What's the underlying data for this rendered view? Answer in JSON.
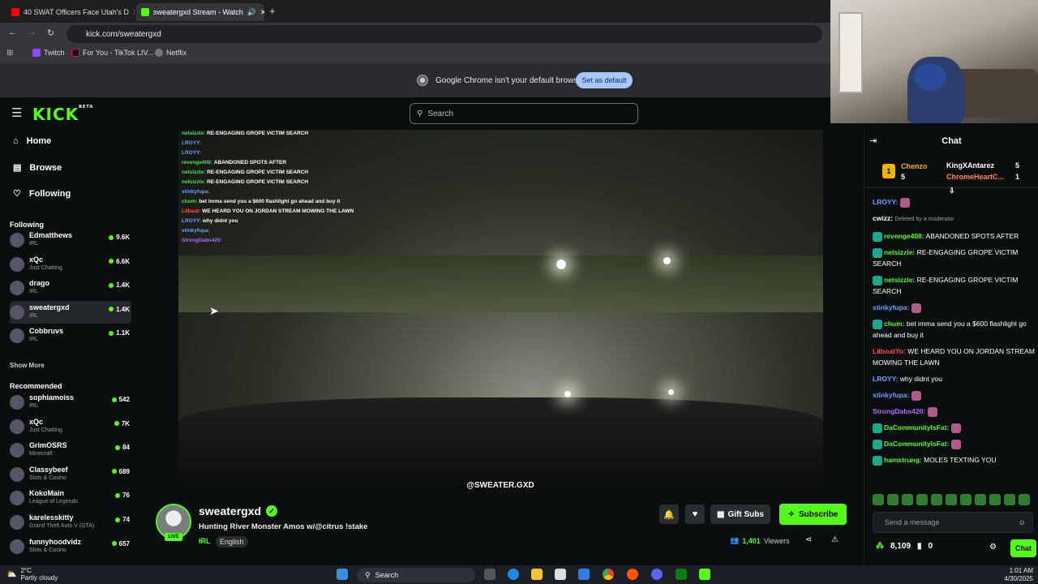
{
  "browser": {
    "tabs": [
      {
        "label": "40 SWAT Officers Face Utah's D",
        "favicon_color": "#ff0000"
      },
      {
        "label": "sweatergxd Stream - Watch",
        "favicon_color": "#53fc18"
      }
    ],
    "url": "kick.com/sweatergxd",
    "bookmarks": [
      "Twitch",
      "For You - TikTok LIV...",
      "Netflix"
    ],
    "infobar_text": "Google Chrome isn't your default browser",
    "infobar_button": "Set as default"
  },
  "header": {
    "logo": "KICK",
    "logo_badge": "BETA",
    "search_placeholder": "Search"
  },
  "sidebar": {
    "nav": [
      {
        "label": "Home",
        "icon": "home-icon"
      },
      {
        "label": "Browse",
        "icon": "browse-icon"
      },
      {
        "label": "Following",
        "icon": "heart-icon"
      }
    ],
    "following_title": "Following",
    "following": [
      {
        "name": "Edmatthews",
        "category": "IRL",
        "viewers": "9.6K"
      },
      {
        "name": "xQc",
        "category": "Just Chatting",
        "viewers": "6.6K"
      },
      {
        "name": "drago",
        "category": "IRL",
        "viewers": "1.4K"
      },
      {
        "name": "sweatergxd",
        "category": "IRL",
        "viewers": "1.4K"
      },
      {
        "name": "Cobbruvs",
        "category": "IRL",
        "viewers": "1.1K"
      }
    ],
    "show_more": "Show More",
    "recommended_title": "Recommended",
    "recommended": [
      {
        "name": "sophiamoiss",
        "category": "IRL",
        "viewers": "542"
      },
      {
        "name": "xQc",
        "category": "Just Chatting",
        "viewers": "7K"
      },
      {
        "name": "GrimOSRS",
        "category": "Minecraft",
        "viewers": "84"
      },
      {
        "name": "Classybeef",
        "category": "Slots & Casino",
        "viewers": "689"
      },
      {
        "name": "KokoMain",
        "category": "League of Legends",
        "viewers": "76"
      },
      {
        "name": "karelesskitty",
        "category": "Grand Theft Auto V (GTA)",
        "viewers": "74"
      },
      {
        "name": "funnyhoodvidz",
        "category": "Slots & Casino",
        "viewers": "657"
      }
    ]
  },
  "video": {
    "overlay_chat": [
      {
        "user": "netsizzle:",
        "text": "RE-ENGAGING GROPE VICTIM SEARCH",
        "color": "#5fd35f"
      },
      {
        "user": "LROYY:",
        "text": "",
        "color": "#6aa0ff"
      },
      {
        "user": "LROYY:",
        "text": "",
        "color": "#6aa0ff"
      },
      {
        "user": "revenge408:",
        "text": "ABANDONED SPOTS AFTER",
        "color": "#5fd35f"
      },
      {
        "user": "netsizzle:",
        "text": "RE-ENGAGING GROPE VICTIM SEARCH",
        "color": "#5fd35f"
      },
      {
        "user": "netsizzle:",
        "text": "RE-ENGAGING GROPE VICTIM SEARCH",
        "color": "#5fd35f"
      },
      {
        "user": "stinkyfupa:",
        "text": "",
        "color": "#6aa0ff"
      },
      {
        "user": "chum:",
        "text": "bet imma send you a $600 flashlight go ahead and buy it",
        "color": "#5fd35f"
      },
      {
        "user": "Lilboat:",
        "text": "WE HEARD YOU ON JORDAN STREAM MOWING THE LAWN",
        "color": "#ff5050"
      },
      {
        "user": "LROYY:",
        "text": "why didnt you",
        "color": "#6aa0ff"
      },
      {
        "user": "stinkyfupa:",
        "text": "",
        "color": "#6aa0ff"
      },
      {
        "user": "StrongDabs420:",
        "text": "",
        "color": "#b06aff"
      }
    ],
    "watermark": "@SWEATER.GXD"
  },
  "channel": {
    "name": "sweatergxd",
    "live_badge": "LIVE",
    "title": "Hunting River Monster Amos w/@citrus !stake",
    "category": "IRL",
    "language": "English",
    "gift_subs": "Gift Subs",
    "subscribe": "Subscribe",
    "viewers_count": "1,401",
    "viewers_label": "Viewers"
  },
  "chat": {
    "title": "Chat",
    "leaderboard": [
      {
        "name": "Chenzo",
        "count": "5"
      },
      {
        "name": "KingXAntarez",
        "count": "5"
      },
      {
        "name": "ChromeHeartC...",
        "count": "1"
      }
    ],
    "messages": [
      {
        "user": "LROYY:",
        "text": "",
        "color": "#6aa0ff"
      },
      {
        "user": "cwizz:",
        "text": "Deleted by a moderator",
        "color": "#ffffff",
        "deleted": true
      },
      {
        "user": "revenge408:",
        "text": "ABANDONED SPOTS AFTER",
        "color": "#53fc18"
      },
      {
        "user": "netsizzle:",
        "text": "RE-ENGAGING GROPE VICTIM SEARCH",
        "color": "#53fc18"
      },
      {
        "user": "netsizzle:",
        "text": "RE-ENGAGING GROPE VICTIM SEARCH",
        "color": "#53fc18"
      },
      {
        "user": "stinkyfupa:",
        "text": "",
        "color": "#6aa0ff"
      },
      {
        "user": "chum:",
        "text": "bet imma send you a $600 flashlight go ahead and buy it",
        "color": "#53fc18"
      },
      {
        "user": "LilboatYo:",
        "text": "WE HEARD YOU ON JORDAN STREAM MOWING THE LAWN",
        "color": "#ff4d4d"
      },
      {
        "user": "LROYY:",
        "text": "why didnt you",
        "color": "#6aa0ff"
      },
      {
        "user": "stinkyfupa:",
        "text": "",
        "color": "#6aa0ff"
      },
      {
        "user": "StrongDabs420:",
        "text": "",
        "color": "#b06aff"
      },
      {
        "user": "DaCommunityIsFat:",
        "text": "",
        "color": "#53fc18"
      },
      {
        "user": "DaCommunityIsFat:",
        "text": "",
        "color": "#53fc18"
      },
      {
        "user": "hamstrung:",
        "text": "MOLES TEXTING YOU",
        "color": "#53fc18"
      }
    ],
    "input_placeholder": "Send a message",
    "points": "8,109",
    "points2": "0",
    "send_button": "Chat"
  },
  "taskbar": {
    "temp": "2°C",
    "weather": "Partly cloudy",
    "search": "Search",
    "time": "1:01 AM",
    "date": "4/30/2025"
  },
  "colors": {
    "accent": "#53fc18",
    "background": "#0b0e0f"
  }
}
